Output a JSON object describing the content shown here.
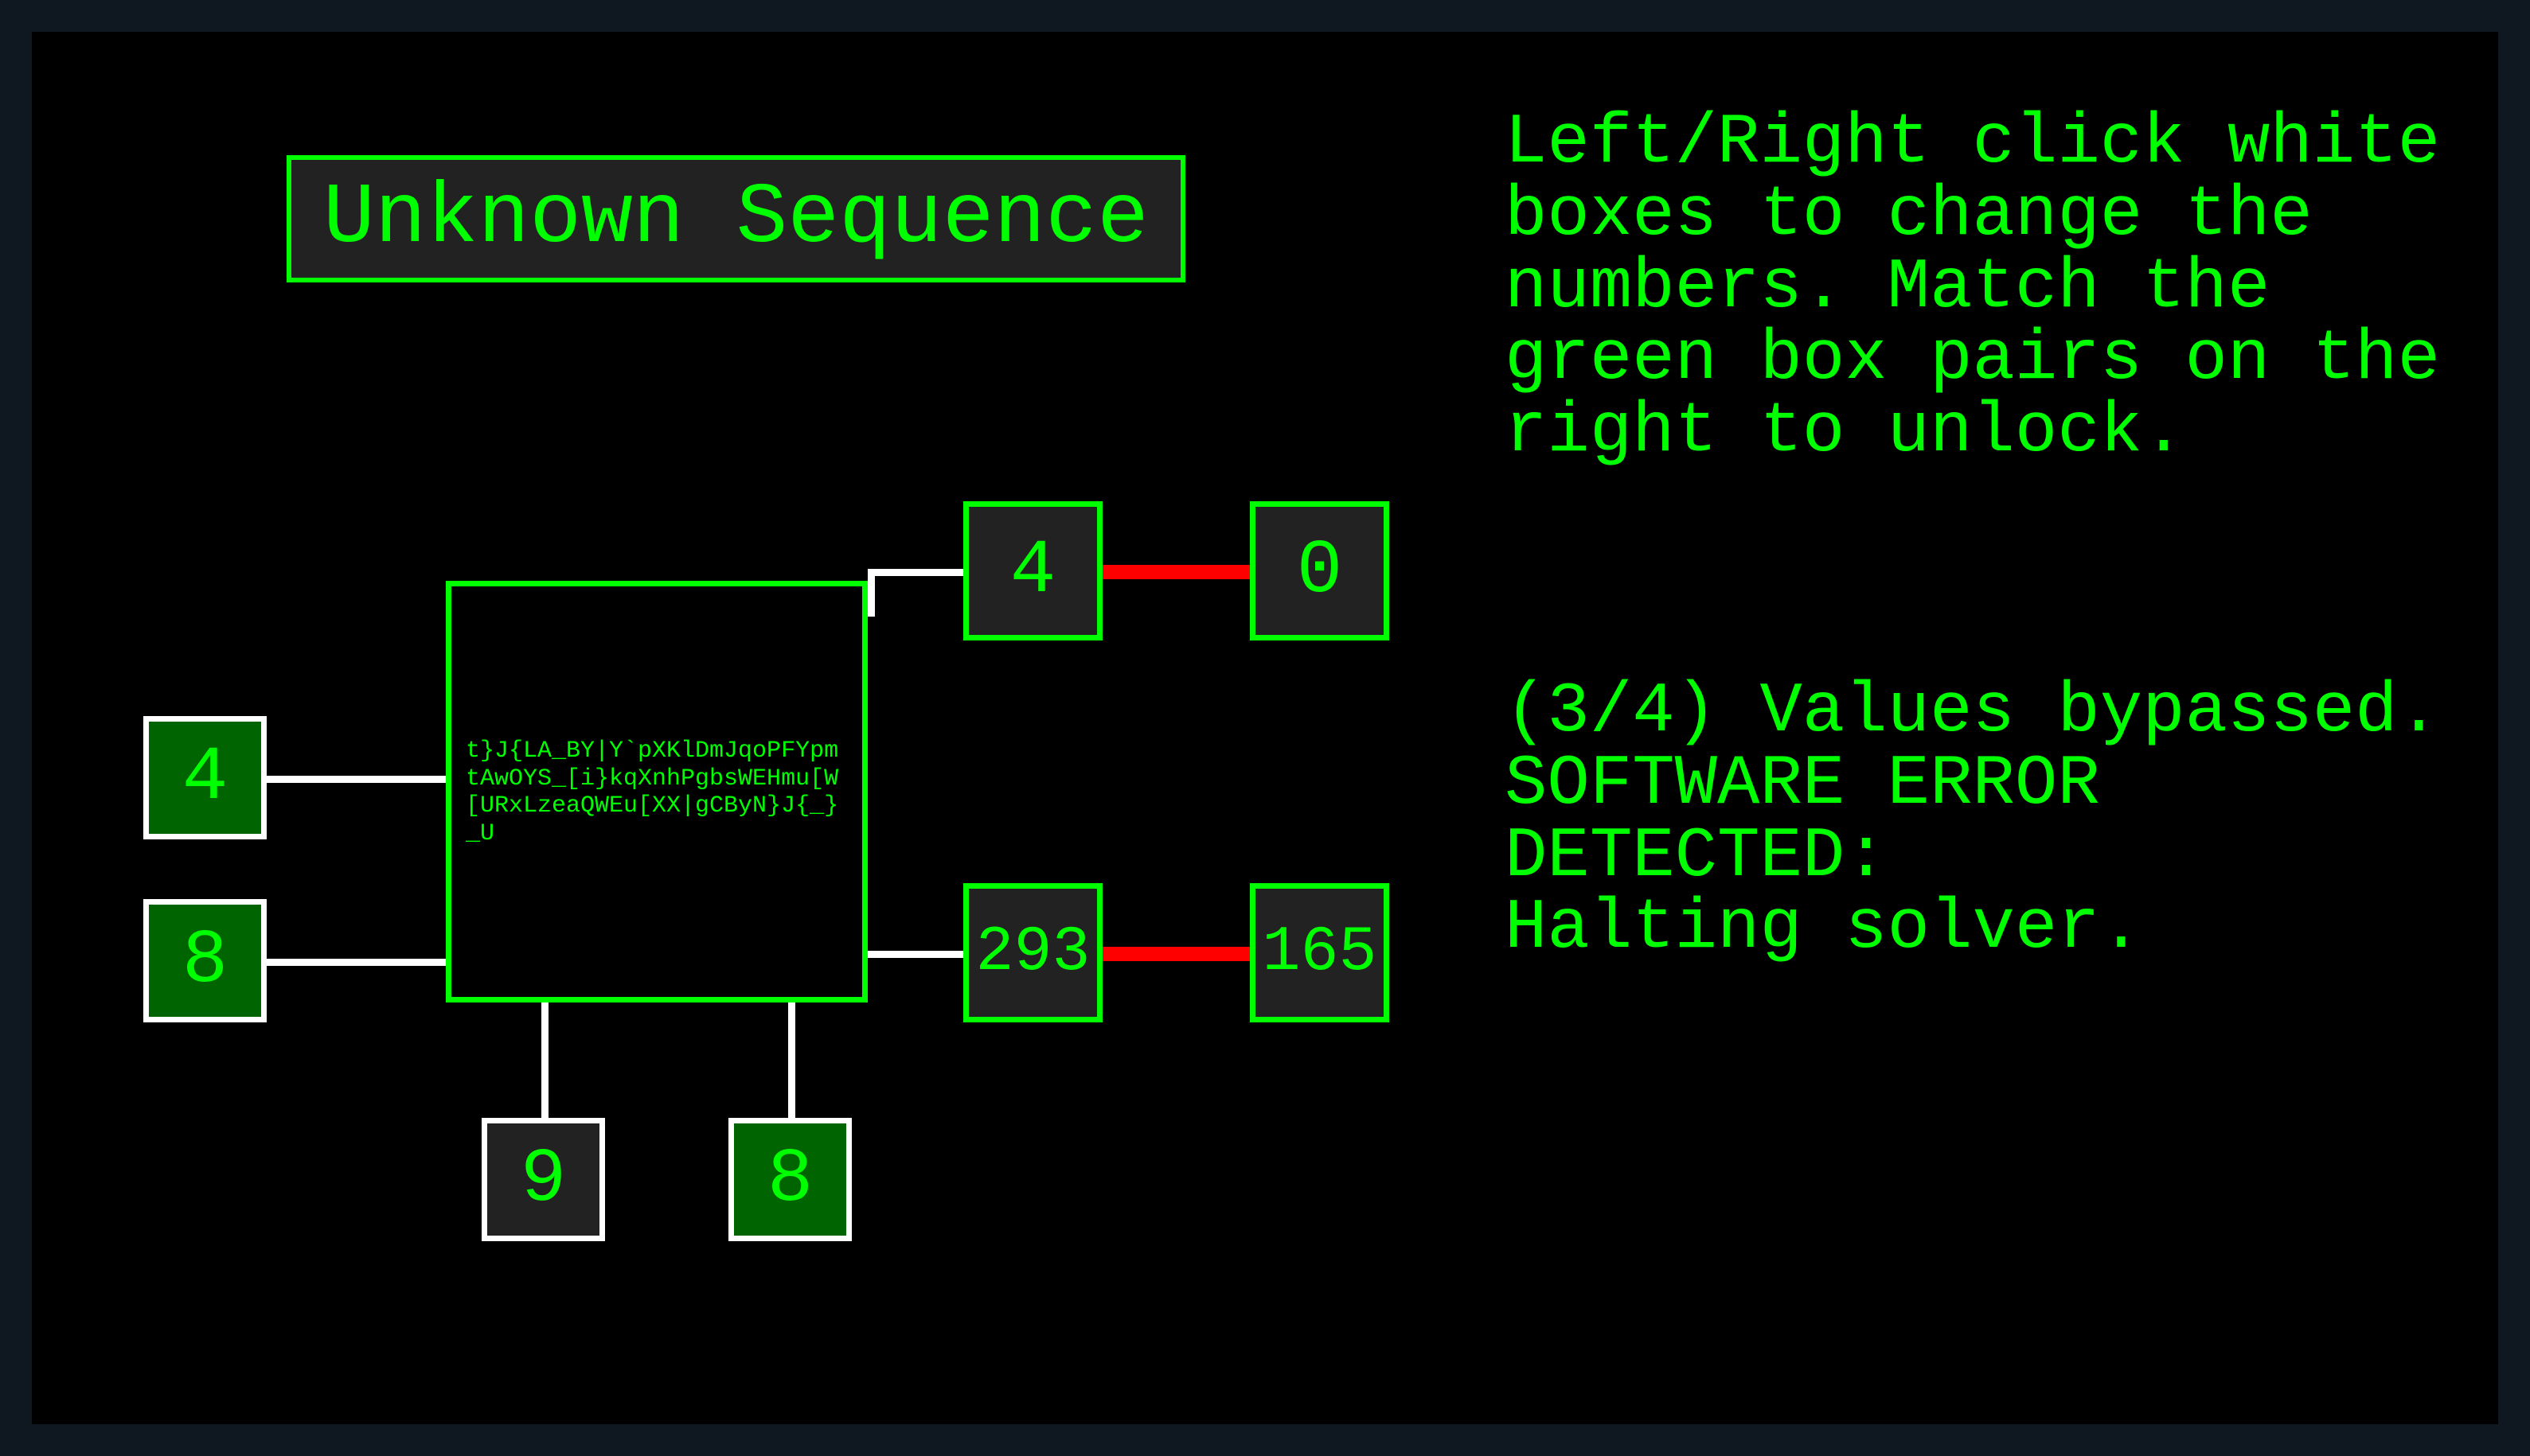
{
  "title": "Unknown Sequence",
  "cipher_text": "t}J{LA_BY|Y`pXKlDmJqoPFYpmtAwOYS_[i}kqXnhPgbsWEHmu[W[URxLzeaQWEu[XX|gCByN}J{_}_U",
  "inputs": {
    "left_a": "4",
    "left_b": "8",
    "bottom_c": "9",
    "bottom_d": "8"
  },
  "outputs": {
    "pair1_out": "4",
    "pair1_target": "0",
    "pair2_out": "293",
    "pair2_target": "165"
  },
  "instructions": "Left/Right click white boxes to change the numbers. Match the green box pairs on the right to unlock.",
  "status": "(3/4) Values bypassed.\nSOFTWARE ERROR DETECTED:\nHalting solver.",
  "colors": {
    "bg_outer": "#0f1820",
    "bg_inner": "#000000",
    "green": "#00ff00",
    "green_solid": "#006400",
    "wire_white": "#ffffff",
    "wire_red": "#ff0000",
    "box_bg": "#222222"
  }
}
